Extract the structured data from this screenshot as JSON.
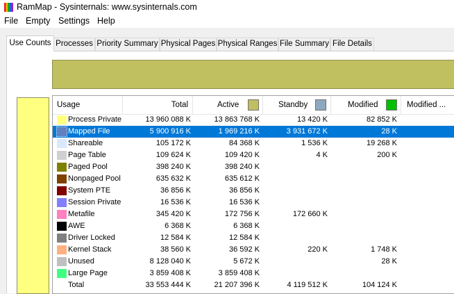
{
  "window": {
    "title": "RamMap - Sysinternals: www.sysinternals.com"
  },
  "menu": [
    "File",
    "Empty",
    "Settings",
    "Help"
  ],
  "tabs": [
    "Use Counts",
    "Processes",
    "Priority Summary",
    "Physical Pages",
    "Physical Ranges",
    "File Summary",
    "File Details"
  ],
  "active_tab": "Use Counts",
  "columns": {
    "usage": "Usage",
    "total": "Total",
    "active": "Active",
    "standby": "Standby",
    "modified": "Modified",
    "modified_more": "Modified ..."
  },
  "column_colors": {
    "active": "#c0c060",
    "standby": "#8ea8c0",
    "modified": "#00c000"
  },
  "chart_colors": {
    "top_bar": "#c0c060",
    "left_bar": "#ffff80"
  },
  "rows": [
    {
      "name": "Process Private",
      "color": "#ffff80",
      "total": "13 960 088 K",
      "active": "13 863 768 K",
      "standby": "13 420 K",
      "modified": "82 852 K"
    },
    {
      "name": "Mapped File",
      "color": "#6080c0",
      "total": "5 900 916 K",
      "active": "1 969 216 K",
      "standby": "3 931 672 K",
      "modified": "28 K",
      "selected": true
    },
    {
      "name": "Shareable",
      "color": "#d8e8ff",
      "total": "105 172 K",
      "active": "84 368 K",
      "standby": "1 536 K",
      "modified": "19 268 K"
    },
    {
      "name": "Page Table",
      "color": "#d0d0d0",
      "total": "109 624 K",
      "active": "109 420 K",
      "standby": "4 K",
      "modified": "200 K"
    },
    {
      "name": "Paged Pool",
      "color": "#808000",
      "total": "398 240 K",
      "active": "398 240 K",
      "standby": "",
      "modified": ""
    },
    {
      "name": "Nonpaged Pool",
      "color": "#804000",
      "total": "635 632 K",
      "active": "635 612 K",
      "standby": "",
      "modified": ""
    },
    {
      "name": "System PTE",
      "color": "#800000",
      "total": "36 856 K",
      "active": "36 856 K",
      "standby": "",
      "modified": ""
    },
    {
      "name": "Session Private",
      "color": "#8080ff",
      "total": "16 536 K",
      "active": "16 536 K",
      "standby": "",
      "modified": ""
    },
    {
      "name": "Metafile",
      "color": "#ff80c0",
      "total": "345 420 K",
      "active": "172 756 K",
      "standby": "172 660 K",
      "modified": ""
    },
    {
      "name": "AWE",
      "color": "#000000",
      "total": "6 368 K",
      "active": "6 368 K",
      "standby": "",
      "modified": ""
    },
    {
      "name": "Driver Locked",
      "color": "#808080",
      "total": "12 584 K",
      "active": "12 584 K",
      "standby": "",
      "modified": ""
    },
    {
      "name": "Kernel Stack",
      "color": "#ffb080",
      "total": "38 560 K",
      "active": "36 592 K",
      "standby": "220 K",
      "modified": "1 748 K"
    },
    {
      "name": "Unused",
      "color": "#c0c0c0",
      "total": "8 128 040 K",
      "active": "5 672 K",
      "standby": "",
      "modified": "28 K"
    },
    {
      "name": "Large Page",
      "color": "#40ff80",
      "total": "3 859 408 K",
      "active": "3 859 408 K",
      "standby": "",
      "modified": ""
    },
    {
      "name": "Total",
      "color": "",
      "total": "33 553 444 K",
      "active": "21 207 396 K",
      "standby": "4 119 512 K",
      "modified": "104 124 K"
    }
  ]
}
